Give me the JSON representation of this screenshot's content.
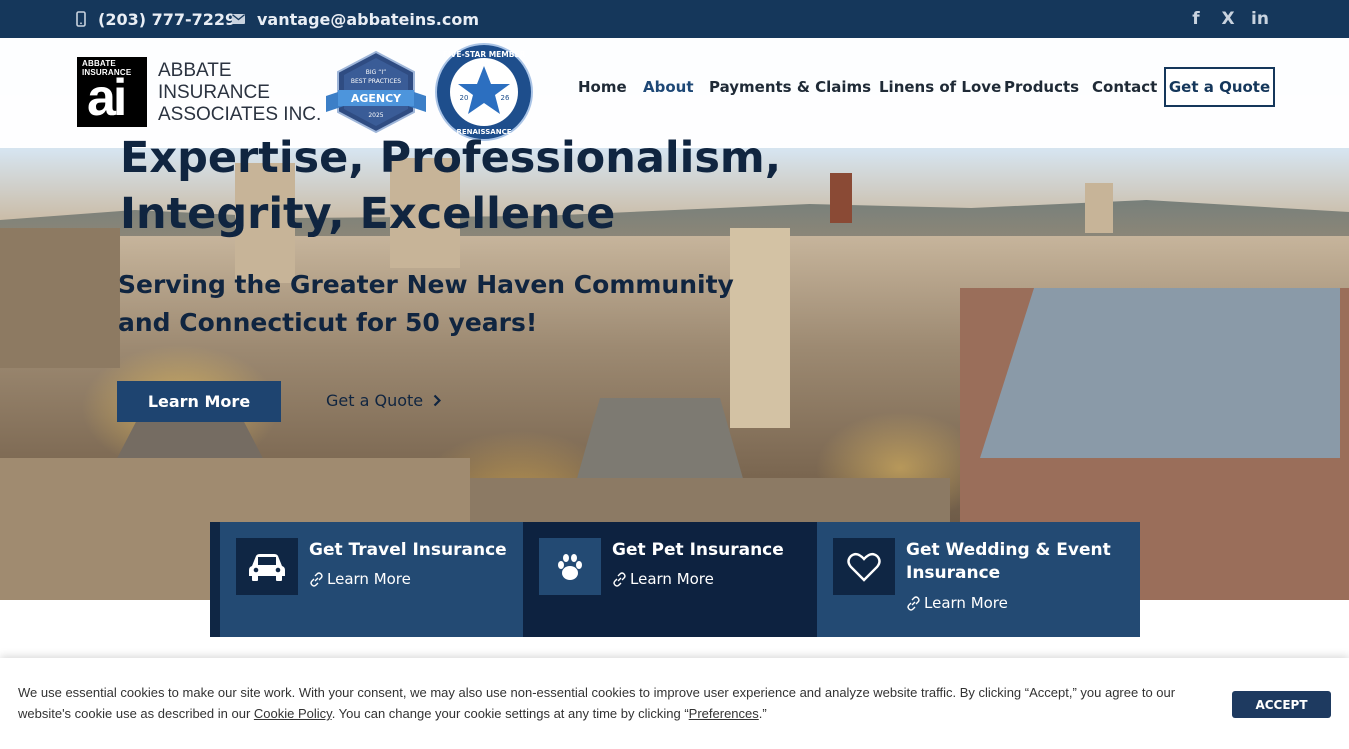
{
  "topbar": {
    "phone": "(203) 777-7229",
    "email": "vantage@abbateins.com",
    "socials": [
      {
        "icon": "facebook-icon",
        "glyph": "f"
      },
      {
        "icon": "x-icon",
        "glyph": "X"
      },
      {
        "icon": "linkedin-icon",
        "glyph": "in"
      }
    ]
  },
  "logo": {
    "small_line1": "ABBATE",
    "small_line2": "INSURANCE",
    "mark": "ai",
    "name_line1": "ABBATE",
    "name_line2": "INSURANCE",
    "name_line3": "ASSOCIATES INC."
  },
  "badges": {
    "best_practices": {
      "line1": "BIG “I”",
      "line2": "BEST PRACTICES",
      "line3": "AGENCY",
      "year": "2025"
    },
    "five_star": {
      "top": "FIVE-STAR MEMBER",
      "left": "20",
      "right": "26",
      "bottom": "RENAISSANCE"
    }
  },
  "nav": {
    "items": [
      "Home",
      "About",
      "Payments & Claims",
      "Linens of Love",
      "Products",
      "Contact"
    ],
    "cta": "Get a Quote"
  },
  "hero": {
    "title_line1": "Expertise, Professionalism,",
    "title_line2": "Integrity, Excellence",
    "sub_line1": "Serving the Greater New Haven Community",
    "sub_line2": "and Connecticut for 50 years!",
    "primary_button": "Learn More",
    "secondary_link": "Get a Quote"
  },
  "cards": [
    {
      "title_line1": "Get Travel Insurance",
      "title_line2": "",
      "link": "Learn More",
      "icon": "car-icon"
    },
    {
      "title_line1": "Get Pet Insurance",
      "title_line2": "",
      "link": "Learn More",
      "icon": "paw-icon"
    },
    {
      "title_line1": "Get Wedding & Event",
      "title_line2": "Insurance",
      "link": "Learn More",
      "icon": "heart-icon"
    }
  ],
  "cookie": {
    "text_part1": "We use essential cookies to make our site work. With your consent, we may also use non-essential cookies to improve user experience and analyze website traffic. By clicking “Accept,” you agree to our website's cookie use as described in our ",
    "policy_link": "Cookie Policy",
    "text_part2": ". You can change your cookie settings at any time by clicking “",
    "preferences_link": "Preferences",
    "text_part3": ".”",
    "accept_button": "ACCEPT"
  },
  "colors": {
    "topbar": "#15375b",
    "brand_navy": "#1e4470",
    "card_light": "#234a73",
    "card_dark": "#0d2240",
    "accept": "#1e3a60"
  }
}
